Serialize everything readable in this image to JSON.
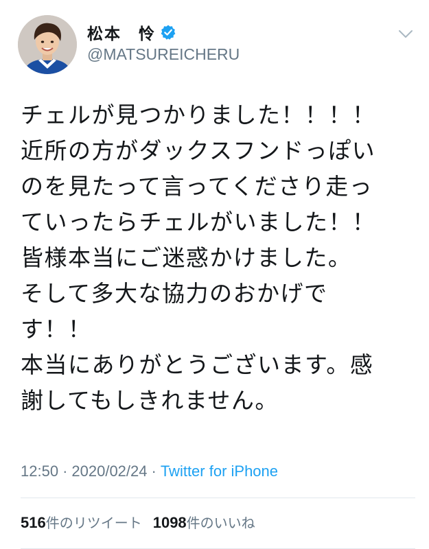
{
  "colors": {
    "text": "#14171a",
    "muted": "#657786",
    "link": "#1da1f2",
    "divider": "#e1e8ed"
  },
  "user": {
    "display_name": "松本　怜",
    "handle": "@MATSUREICHERU",
    "verified_icon": "verified-badge-icon",
    "avatar_icon": "avatar"
  },
  "menu": {
    "caret_icon": "chevron-down-icon"
  },
  "tweet": {
    "lines": [
      "チェルが見つかりました！！！！",
      "近所の方がダックスフンドっぽい",
      "のを見たって言ってくださり走っ",
      "ていったらチェルがいました！！",
      "皆様本当にご迷惑かけました。",
      "そして多大な協力のおかげで",
      "す！！",
      "本当にありがとうございます。感",
      "謝してもしきれません。"
    ]
  },
  "meta": {
    "time": "12:50",
    "separator_1": "·",
    "date": "2020/02/24",
    "separator_2": "·",
    "source": "Twitter for iPhone"
  },
  "stats": {
    "retweets_count": "516",
    "retweets_label": "件のリツイート",
    "likes_count": "1098",
    "likes_label": "件のいいね"
  }
}
